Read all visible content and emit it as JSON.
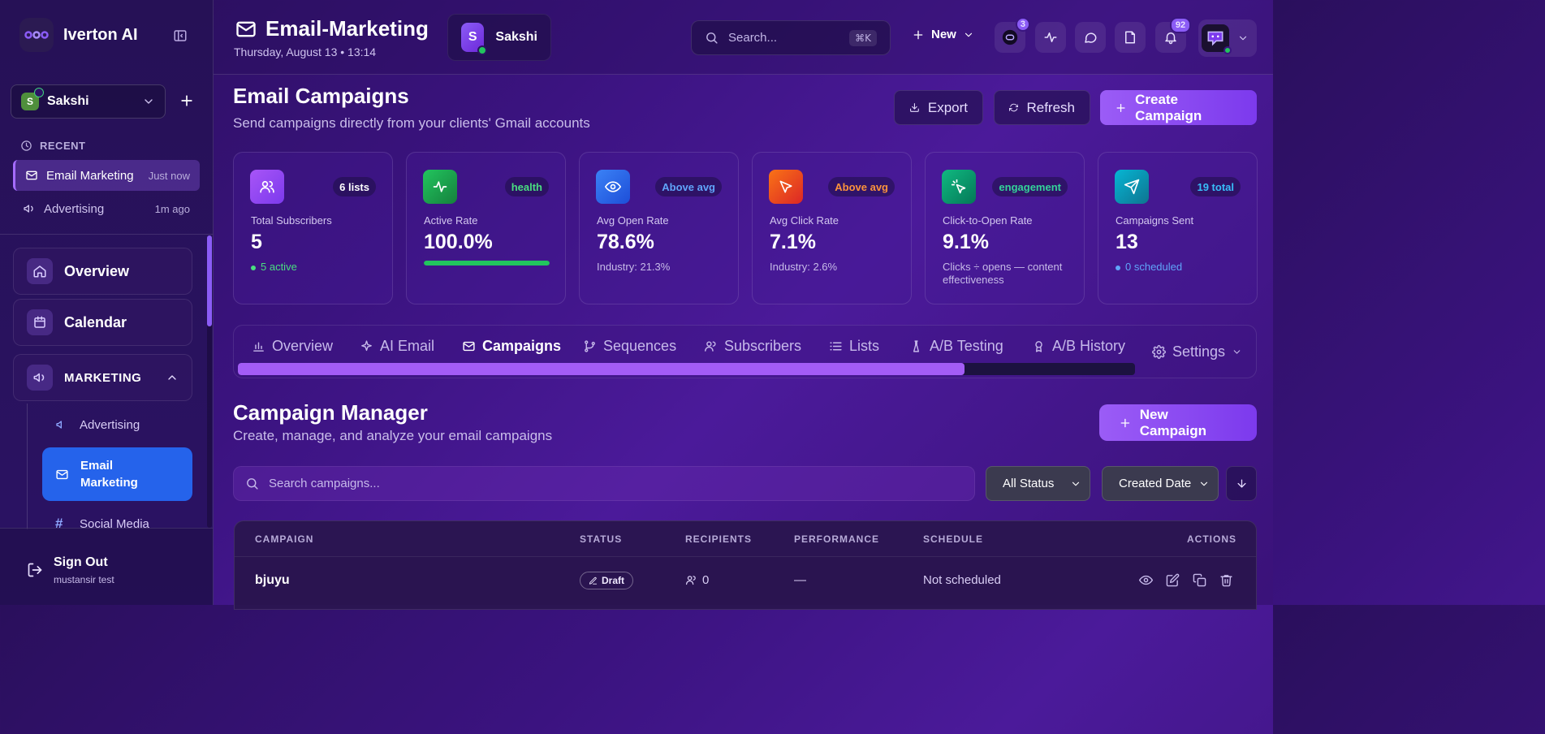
{
  "sidebar": {
    "brand": "Iverton AI",
    "workspace": {
      "initial": "S",
      "name": "Sakshi"
    },
    "recent_label": "RECENT",
    "recent": [
      {
        "label": "Email Marketing",
        "time": "Just now"
      },
      {
        "label": "Advertising",
        "time": "1m ago"
      }
    ],
    "nav": {
      "overview": "Overview",
      "calendar": "Calendar",
      "marketing": "MARKETING"
    },
    "sub": {
      "advertising": "Advertising",
      "email_marketing": "Email Marketing",
      "social_media": "Social Media"
    },
    "signout": {
      "title": "Sign Out",
      "user": "mustansir test"
    }
  },
  "header": {
    "title": "Email-Marketing",
    "date": "Thursday, August 13 • 13:14",
    "user_chip": {
      "initial": "S",
      "name": "Sakshi"
    },
    "search": {
      "placeholder": "Search...",
      "shortcut": "⌘K"
    },
    "new_label": "New",
    "badges": {
      "assistant": "3",
      "notifications": "92"
    }
  },
  "campaigns": {
    "title": "Email Campaigns",
    "subtitle": "Send campaigns directly from your clients' Gmail accounts",
    "export": "Export",
    "refresh": "Refresh",
    "create": "Create Campaign"
  },
  "stats": [
    {
      "label": "Total Subscribers",
      "value": "5",
      "badge": "6 lists",
      "note": "5 active",
      "color": "#a855f7"
    },
    {
      "label": "Active Rate",
      "value": "100.0%",
      "badge": "health",
      "progress": 1.0,
      "color": "#22c55e"
    },
    {
      "label": "Avg Open Rate",
      "value": "78.6%",
      "badge": "Above avg",
      "note": "Industry: 21.3%",
      "color": "#3b82f6"
    },
    {
      "label": "Avg Click Rate",
      "value": "7.1%",
      "badge": "Above avg",
      "note": "Industry: 2.6%",
      "color": "#f97316"
    },
    {
      "label": "Click-to-Open Rate",
      "value": "9.1%",
      "badge": "engagement",
      "note": "Clicks ÷ opens — content effectiveness",
      "color": "#10b981"
    },
    {
      "label": "Campaigns Sent",
      "value": "13",
      "badge": "19 total",
      "note": "0 scheduled",
      "color": "#06b6d4"
    }
  ],
  "tabs": {
    "items": [
      "Overview",
      "AI Email",
      "Campaigns",
      "Sequences",
      "Subscribers",
      "Lists",
      "A/B Testing",
      "A/B History"
    ],
    "active": "Campaigns",
    "settings": "Settings",
    "scroll_fraction": 0.81
  },
  "manager": {
    "title": "Campaign Manager",
    "subtitle": "Create, manage, and analyze your email campaigns",
    "new_button": "New Campaign",
    "search_placeholder": "Search campaigns...",
    "status_filter": "All Status",
    "sort_by": "Created Date"
  },
  "table": {
    "headers": [
      "CAMPAIGN",
      "STATUS",
      "RECIPIENTS",
      "PERFORMANCE",
      "SCHEDULE",
      "ACTIONS"
    ],
    "rows": [
      {
        "name": "bjuyu",
        "status": "Draft",
        "recipients": "0",
        "performance": "—",
        "schedule": "Not scheduled"
      }
    ]
  }
}
